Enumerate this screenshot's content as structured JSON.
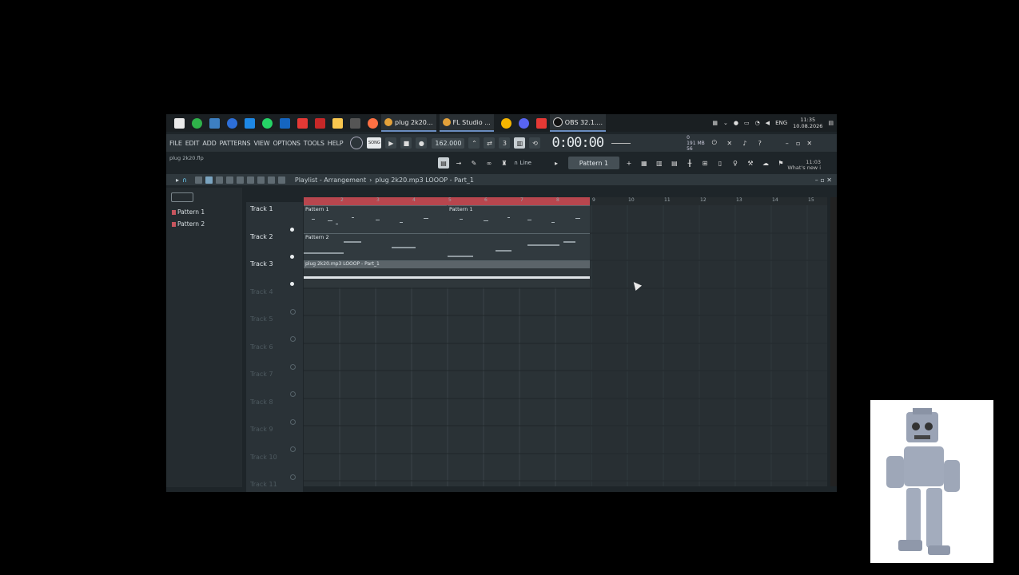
{
  "taskbar": {
    "tasks": [
      {
        "label": "plug 2k20...",
        "color": "#e4a13a"
      },
      {
        "label": "FL Studio ...",
        "color": "#e4a13a"
      },
      {
        "label": "OBS 32.1....",
        "color": "#dddddd"
      }
    ],
    "tray": {
      "lang": "ENG",
      "time": "11:35",
      "date": "10.08.2026"
    }
  },
  "menu": {
    "items": [
      "FILE",
      "EDIT",
      "ADD",
      "PATTERNS",
      "VIEW",
      "OPTIONS",
      "TOOLS",
      "HELP"
    ]
  },
  "transport": {
    "mode": "SONG",
    "tempo": "162.000",
    "time": "0:00:00",
    "cpu": "0",
    "ram": "191 MB",
    "voices": "56"
  },
  "project_file": "plug 2k20.flp",
  "toolbar2": {
    "snap": "Line",
    "pattern": "Pattern 1"
  },
  "whats_new": {
    "line1": "11:03",
    "line2": "What's new i"
  },
  "playlist": {
    "title": "Playlist - Arrangement",
    "breadcrumb": "plug 2k20.mp3 LOOOP - Part_1",
    "picker": [
      "Pattern 1",
      "Pattern 2"
    ],
    "tracks": [
      "Track 1",
      "Track 2",
      "Track 3",
      "Track 4",
      "Track 5",
      "Track 6",
      "Track 7",
      "Track 8",
      "Track 9",
      "Track 10",
      "Track 11"
    ],
    "ruler": [
      "2",
      "3",
      "4",
      "5",
      "6",
      "7",
      "8",
      "9",
      "10",
      "11",
      "12",
      "13",
      "14",
      "15"
    ],
    "clips": {
      "track1a": "Pattern 1",
      "track1b": "Pattern 1",
      "track2": "Pattern 2",
      "track3": "plug 2k20.mp3 LOOOP - Part_1"
    }
  }
}
